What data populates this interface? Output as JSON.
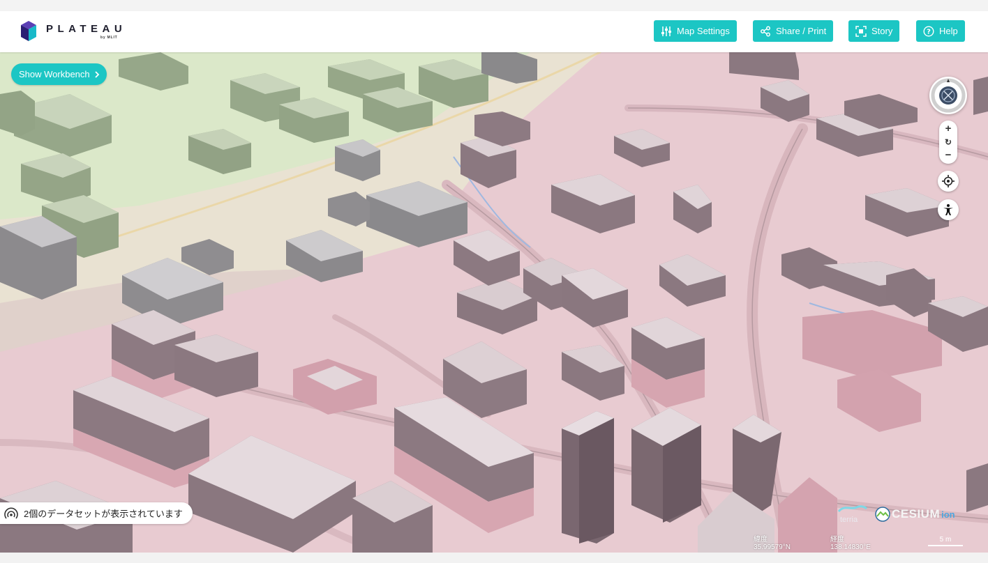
{
  "header": {
    "logo_text": "PLATEAU",
    "logo_sub": "by MLIT",
    "buttons": {
      "map_settings": "Map Settings",
      "share_print": "Share / Print",
      "story": "Story",
      "help": "Help"
    }
  },
  "workbench": {
    "label": "Show Workbench"
  },
  "map_controls": {
    "zoom_in": "+",
    "zoom_out": "−",
    "reset": "↻"
  },
  "datasets": {
    "label": "2個のデータセットが表示されています"
  },
  "credits": {
    "terria": "terria",
    "cesium": "CESIUM",
    "ion": "ion"
  },
  "coordinates": {
    "lat_label": "緯度",
    "lat_value": "35.99579°N",
    "lon_label": "経度",
    "lon_value": "138.14830°E"
  },
  "scale": {
    "label": "5 m"
  },
  "colors": {
    "accent": "#1cc6c4",
    "map_pink": "#e7c9cf",
    "map_green": "#d8e6c6"
  },
  "icons": {
    "map_settings": "sliders-icon",
    "share_print": "share-icon",
    "story": "story-focus-icon",
    "help": "help-circle-icon",
    "compass": "compass-icon",
    "locate": "crosshair-icon",
    "accessibility": "accessibility-icon",
    "datasets": "broadcast-icon"
  }
}
